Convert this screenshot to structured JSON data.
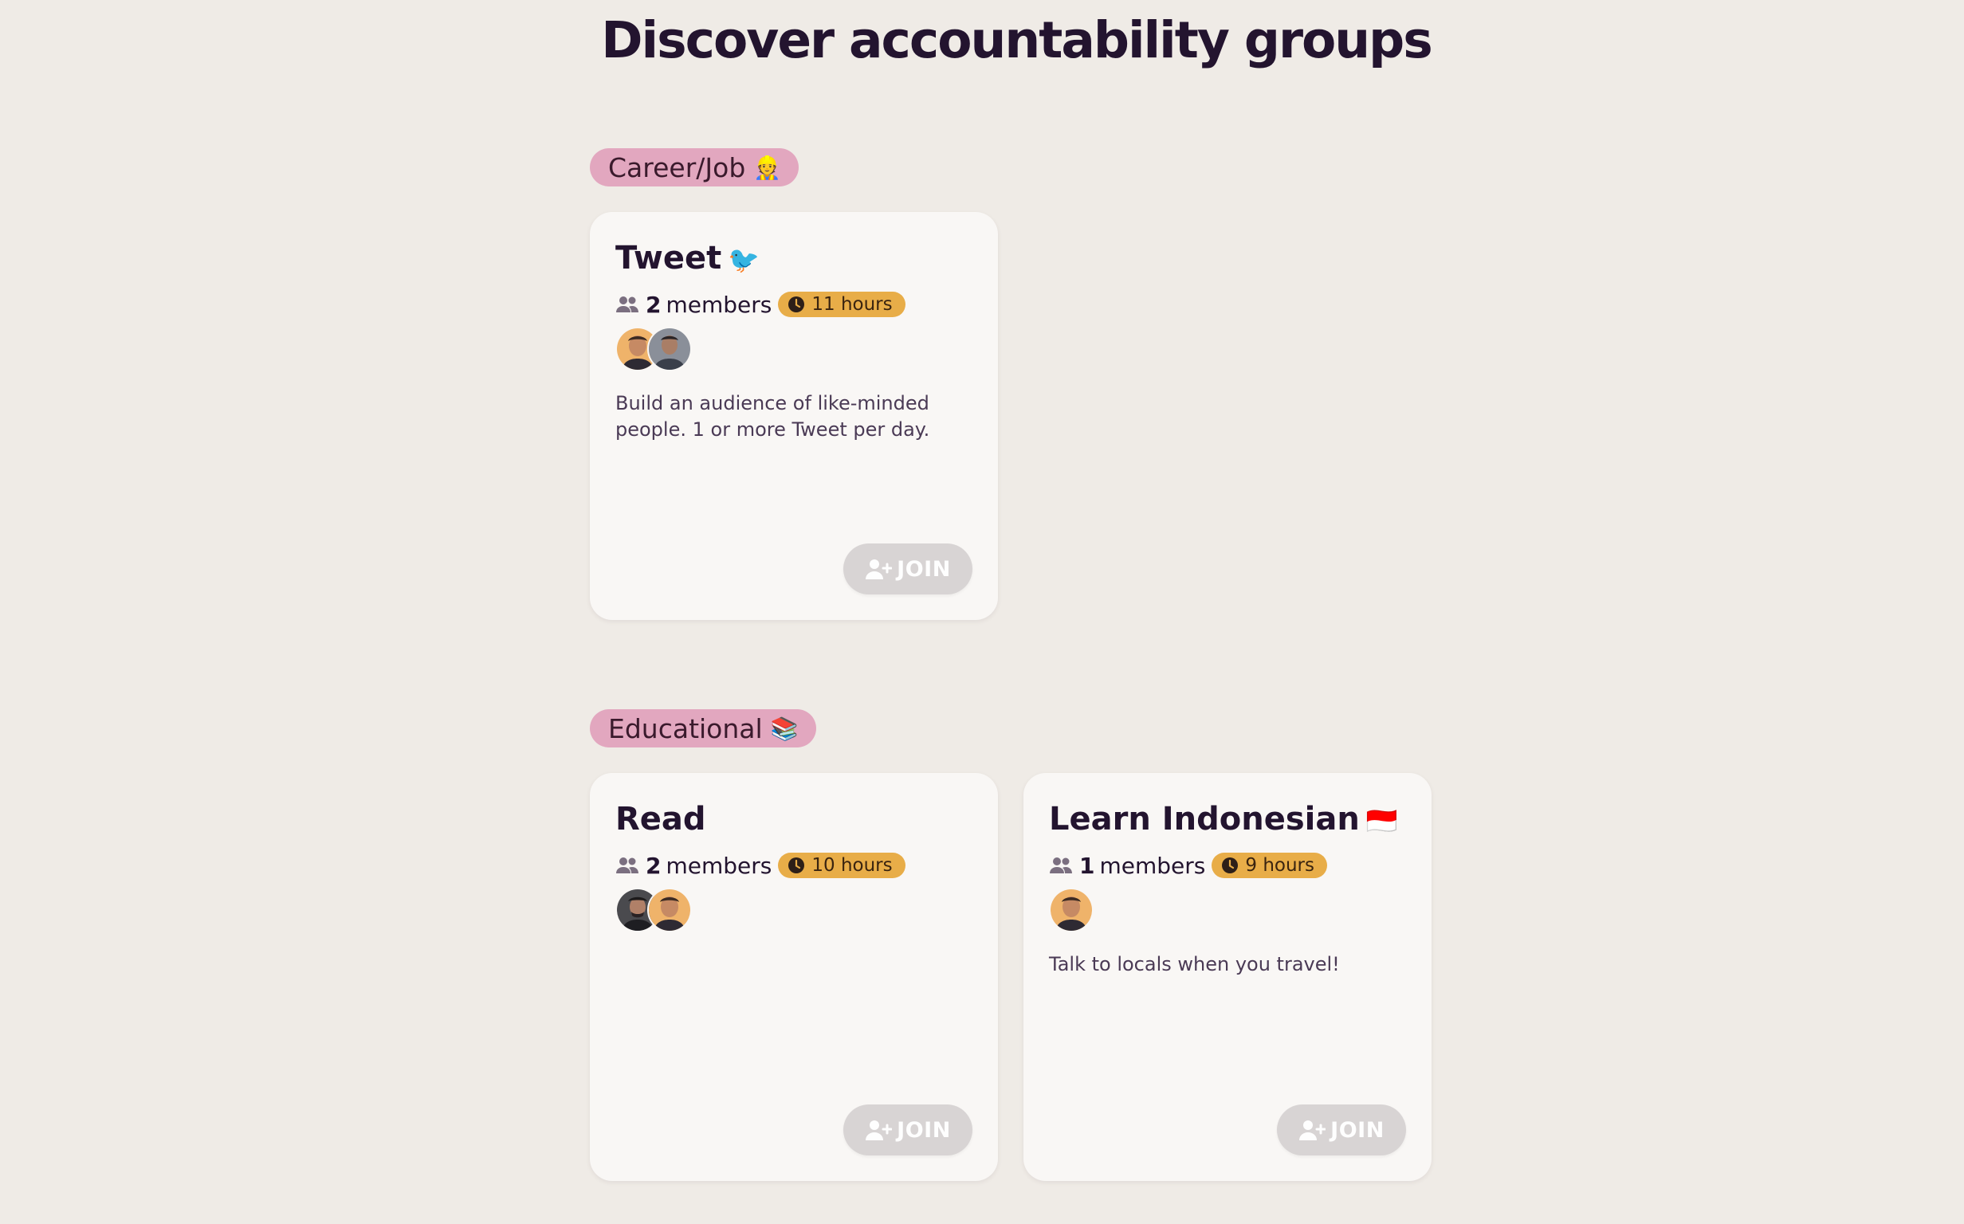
{
  "page": {
    "title": "Discover accountability groups"
  },
  "sections": [
    {
      "category": "Career/Job",
      "category_emoji": "👷",
      "groups": [
        {
          "title": "Tweet",
          "title_emoji": "🐦",
          "member_count": "2",
          "members_label": "members",
          "time_label": "11 hours",
          "avatars": [
            "avatar-orange",
            "avatar-gray"
          ],
          "description": "Build an audience of like-minded people. 1 or more Tweet per day.",
          "join_label": "JOIN"
        }
      ]
    },
    {
      "category": "Educational",
      "category_emoji": "📚",
      "groups": [
        {
          "title": "Read",
          "title_emoji": "",
          "member_count": "2",
          "members_label": "members",
          "time_label": "10 hours",
          "avatars": [
            "avatar-dark",
            "avatar-orange"
          ],
          "description": "",
          "join_label": "JOIN"
        },
        {
          "title": "Learn Indonesian",
          "title_emoji": "🇮🇩",
          "member_count": "1",
          "members_label": "members",
          "time_label": "9 hours",
          "avatars": [
            "avatar-orange"
          ],
          "description": "Talk to locals when you travel!",
          "join_label": "JOIN"
        }
      ]
    }
  ],
  "colors": {
    "background": "#efebe6",
    "category_pill": "#e2a7bf",
    "time_pill": "#e8ad48",
    "card": "#f9f7f5",
    "join_button_disabled": "#d7d3d3",
    "text_primary": "#23142f"
  },
  "icons": {
    "members": "members-icon",
    "clock": "clock-icon",
    "join": "add-user-icon"
  }
}
